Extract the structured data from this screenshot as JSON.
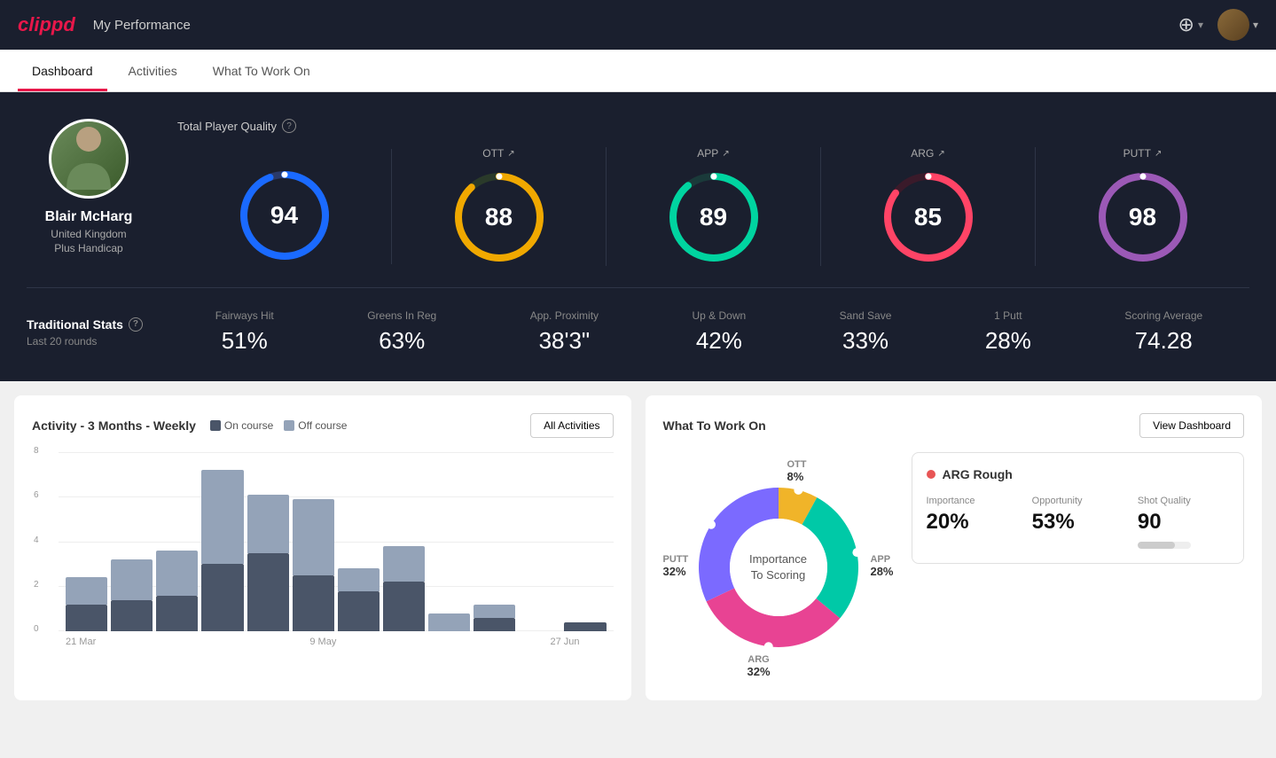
{
  "header": {
    "logo": "clippd",
    "title": "My Performance",
    "add_label": "+",
    "chevron_label": "▾"
  },
  "nav": {
    "tabs": [
      {
        "label": "Dashboard",
        "active": true
      },
      {
        "label": "Activities",
        "active": false
      },
      {
        "label": "What To Work On",
        "active": false
      }
    ]
  },
  "player": {
    "name": "Blair McHarg",
    "country": "United Kingdom",
    "handicap": "Plus Handicap"
  },
  "scores": {
    "tpq_label": "Total Player Quality",
    "items": [
      {
        "key": "total",
        "label": "",
        "value": 94,
        "color_start": "#1a6aff",
        "color_end": "#1a6aff",
        "track_color": "#2a3a6a"
      },
      {
        "key": "ott",
        "label": "OTT",
        "value": 88,
        "color_start": "#f0a800",
        "color_end": "#f0a800",
        "track_color": "#2a3a2a"
      },
      {
        "key": "app",
        "label": "APP",
        "value": 89,
        "color_start": "#00d4a0",
        "color_end": "#00d4a0",
        "track_color": "#1a3a3a"
      },
      {
        "key": "arg",
        "label": "ARG",
        "value": 85,
        "color_start": "#ff4466",
        "color_end": "#ff4466",
        "track_color": "#3a1a2a"
      },
      {
        "key": "putt",
        "label": "PUTT",
        "value": 98,
        "color_start": "#9b59b6",
        "color_end": "#9b59b6",
        "track_color": "#2a1a3a"
      }
    ]
  },
  "traditional_stats": {
    "label": "Traditional Stats",
    "sublabel": "Last 20 rounds",
    "stats": [
      {
        "name": "Fairways Hit",
        "value": "51%"
      },
      {
        "name": "Greens In Reg",
        "value": "63%"
      },
      {
        "name": "App. Proximity",
        "value": "38'3\""
      },
      {
        "name": "Up & Down",
        "value": "42%"
      },
      {
        "name": "Sand Save",
        "value": "33%"
      },
      {
        "name": "1 Putt",
        "value": "28%"
      },
      {
        "name": "Scoring Average",
        "value": "74.28"
      }
    ]
  },
  "activity_chart": {
    "title": "Activity - 3 Months - Weekly",
    "legend": {
      "on_course": "On course",
      "off_course": "Off course"
    },
    "all_activities_btn": "All Activities",
    "y_labels": [
      "8",
      "6",
      "4",
      "2",
      "0"
    ],
    "x_labels": [
      "21 Mar",
      "9 May",
      "27 Jun"
    ],
    "bars": [
      {
        "on": 12,
        "off": 12
      },
      {
        "on": 14,
        "off": 18
      },
      {
        "on": 16,
        "off": 20
      },
      {
        "on": 30,
        "off": 42
      },
      {
        "on": 35,
        "off": 26
      },
      {
        "on": 25,
        "off": 34
      },
      {
        "on": 18,
        "off": 10
      },
      {
        "on": 22,
        "off": 16
      },
      {
        "on": 0,
        "off": 8
      },
      {
        "on": 6,
        "off": 6
      },
      {
        "on": 0,
        "off": 0
      },
      {
        "on": 4,
        "off": 0
      }
    ],
    "max_val": 80
  },
  "what_to_work_on": {
    "title": "What To Work On",
    "view_dashboard_btn": "View Dashboard",
    "donut": {
      "center_line1": "Importance",
      "center_line2": "To Scoring",
      "segments": [
        {
          "label": "OTT",
          "value": "8%",
          "color": "#f0b429",
          "offset_pct": 0
        },
        {
          "label": "APP",
          "value": "28%",
          "color": "#00c9a7",
          "offset_pct": 8
        },
        {
          "label": "ARG",
          "value": "32%",
          "color": "#e84393",
          "offset_pct": 36
        },
        {
          "label": "PUTT",
          "value": "32%",
          "color": "#7b6aff",
          "offset_pct": 68
        }
      ]
    },
    "detail_card": {
      "title": "ARG Rough",
      "dot_color": "#e85555",
      "metrics": [
        {
          "name": "Importance",
          "value": "20%"
        },
        {
          "name": "Opportunity",
          "value": "53%"
        },
        {
          "name": "Shot Quality",
          "value": "90"
        }
      ]
    }
  }
}
